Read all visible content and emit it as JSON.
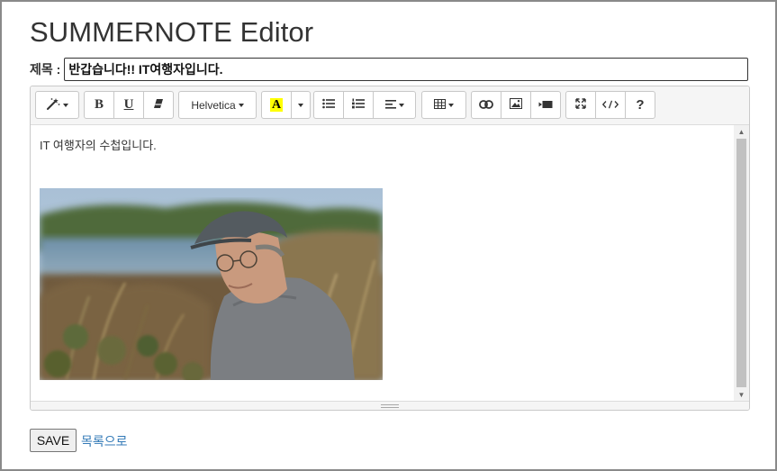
{
  "page": {
    "title": "SUMMERNOTE Editor"
  },
  "form": {
    "title_label": "제목 :",
    "title_value": "반갑습니다!! IT여행자입니다."
  },
  "toolbar": {
    "font_name": "Helvetica",
    "help_label": "?",
    "bold_label": "B",
    "underline_label": "U",
    "color_letter": "A",
    "color_highlight": "#ffff00",
    "groups": [
      [
        "magic-icon"
      ],
      [
        "bold-button",
        "underline-button",
        "eraser-icon"
      ],
      [
        "font-name-dropdown"
      ],
      [
        "color-button",
        "color-dropdown"
      ],
      [
        "unordered-list-icon",
        "ordered-list-icon",
        "align-left-icon"
      ],
      [
        "table-icon"
      ],
      [
        "link-icon",
        "picture-icon",
        "video-icon"
      ],
      [
        "fullscreen-icon",
        "code-view-icon",
        "help-button"
      ]
    ]
  },
  "content": {
    "text": "IT 여행자의 수첩입니다."
  },
  "actions": {
    "save_label": "SAVE",
    "list_link_label": "목록으로"
  }
}
